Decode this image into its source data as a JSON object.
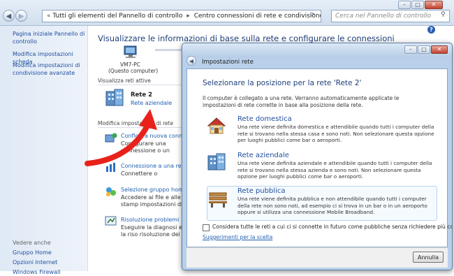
{
  "explorer": {
    "breadcrumb": [
      "Tutti gli elementi del Pannello di controllo",
      "Centro connessioni di rete e condivisione"
    ],
    "search_placeholder": "Cerca nel Pannello di controllo"
  },
  "sidebar": {
    "items": [
      {
        "label": "Pagina iniziale Pannello di controllo"
      },
      {
        "label": "Modifica impostazioni scheda"
      },
      {
        "label": "Modifica impostazioni di condivisione avanzate"
      }
    ],
    "see_also": {
      "heading": "Vedere anche",
      "items": [
        {
          "label": "Gruppo Home"
        },
        {
          "label": "Opzioni Internet"
        },
        {
          "label": "Windows Firewall"
        }
      ]
    }
  },
  "main": {
    "title": "Visualizzare le informazioni di base sulla rete e configurare le connessioni",
    "computer_name": "VM7-PC",
    "computer_caption": "(Questo computer)",
    "active_networks_label": "Visualizza reti attive",
    "network_name": "Rete  2",
    "network_type": "Rete aziendale",
    "change_settings_label": "Modifica impostazioni di rete",
    "actions": [
      {
        "title": "Configura nuova connessione",
        "desc": "Configurare una connessione o un punto di accesso"
      },
      {
        "title": "Connessione a una rete",
        "desc": "Connettere o riconnettere"
      },
      {
        "title": "Selezione gruppo home e o",
        "desc": "Accedere ai file e alle stamp impostazioni di condivisio"
      },
      {
        "title": "Risoluzione problemi",
        "desc": "Eseguire la diagnosi e la riso risoluzione dei problemi."
      }
    ]
  },
  "dialog": {
    "title": "Impostazioni rete",
    "heading": "Selezionare la posizione per la rete 'Rete  2'",
    "intro": "Il computer è collegato a una rete. Verranno automaticamente applicate le impostazioni di rete corrette in base alla posizione della rete.",
    "options": [
      {
        "title": "Rete domestica",
        "desc": "Una rete viene definita domestica e attendibile quando tutti i computer della rete si trovano nella stessa casa e sono noti. Non selezionare questa opzione per luoghi pubblici come bar o aeroporti.",
        "icon": "house-icon"
      },
      {
        "title": "Rete aziendale",
        "desc": "Una rete viene definita aziendale e attendibile quando tutti i computer della rete si trovano nella stessa azienda e sono noti. Non selezionare questa opzione per luoghi pubblici come bar o aeroporti.",
        "icon": "office-building-icon"
      },
      {
        "title": "Rete pubblica",
        "desc": "Una rete viene definita pubblica e non attendibile quando tutti i computer della rete non sono noti, ad esempio ci si trova in un bar o in un aeroporto oppure si utilizza una connessione Mobile Broadband.",
        "icon": "park-bench-icon"
      }
    ],
    "checkbox_label": "Considera tutte le reti a cui ci si connette in futuro come pubbliche senza richiedere più conferma",
    "help_link": "Suggerimenti per la scelta",
    "cancel_label": "Annulla"
  },
  "colors": {
    "arrow": "#e8221b",
    "link": "#1f5fb0",
    "title": "#1e3f7a"
  }
}
